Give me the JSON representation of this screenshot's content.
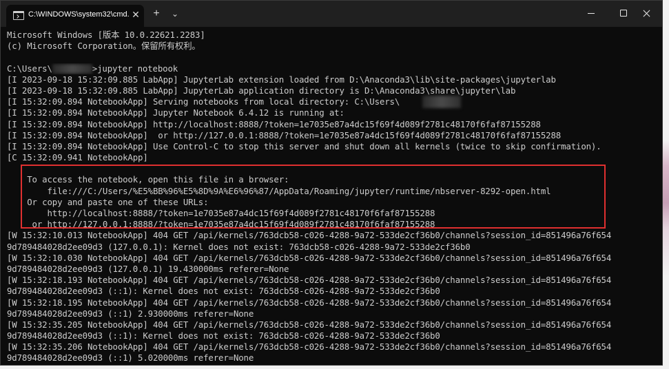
{
  "window": {
    "tab_title": "C:\\WINDOWS\\system32\\cmd.",
    "tab_close_glyph": "✕",
    "new_tab_glyph": "+",
    "dropdown_glyph": "⌄",
    "colors": {
      "console_bg": "#0c0c0c",
      "console_text": "#cccccc",
      "titlebar_bg": "#202020",
      "highlight_border": "#e03030"
    }
  },
  "console": {
    "lines": [
      "Microsoft Windows [版本 10.0.22621.2283]",
      "(c) Microsoft Corporation。保留所有权利。",
      "",
      "C:\\Users\\",
      "[I 2023-09-18 15:32:09.885 LabApp] JupyterLab extension loaded from D:\\Anaconda3\\lib\\site-packages\\jupyterlab",
      "[I 2023-09-18 15:32:09.885 LabApp] JupyterLab application directory is D:\\Anaconda3\\share\\jupyter\\lab",
      "[I 15:32:09.894 NotebookApp] Serving notebooks from local directory: C:\\Users\\",
      "[I 15:32:09.894 NotebookApp] Jupyter Notebook 6.4.12 is running at:",
      "[I 15:32:09.894 NotebookApp] http://localhost:8888/?token=1e7035e87a4dc15f69f4d089f2781c48170f6faf87155288",
      "[I 15:32:09.894 NotebookApp]  or http://127.0.0.1:8888/?token=1e7035e87a4dc15f69f4d089f2781c48170f6faf87155288",
      "[I 15:32:09.894 NotebookApp] Use Control-C to stop this server and shut down all kernels (twice to skip confirmation).",
      "[C 15:32:09.941 NotebookApp]",
      "",
      "    To access the notebook, open this file in a browser:",
      "        file:///C:/Users/%E5%BB%96%E5%8D%9A%E6%96%87/AppData/Roaming/jupyter/runtime/nbserver-8292-open.html",
      "    Or copy and paste one of these URLs:",
      "        http://localhost:8888/?token=1e7035e87a4dc15f69f4d089f2781c48170f6faf87155288",
      "     or http://127.0.0.1:8888/?token=1e7035e87a4dc15f69f4d089f2781c48170f6faf87155288",
      "[W 15:32:10.013 NotebookApp] 404 GET /api/kernels/763dcb58-c026-4288-9a72-533de2cf36b0/channels?session_id=851496a76f654",
      "9d789484028d2ee09d3 (127.0.0.1): Kernel does not exist: 763dcb58-c026-4288-9a72-533de2cf36b0",
      "[W 15:32:10.030 NotebookApp] 404 GET /api/kernels/763dcb58-c026-4288-9a72-533de2cf36b0/channels?session_id=851496a76f654",
      "9d789484028d2ee09d3 (127.0.0.1) 19.430000ms referer=None",
      "[W 15:32:18.193 NotebookApp] 404 GET /api/kernels/763dcb58-c026-4288-9a72-533de2cf36b0/channels?session_id=851496a76f654",
      "9d789484028d2ee09d3 (::1): Kernel does not exist: 763dcb58-c026-4288-9a72-533de2cf36b0",
      "[W 15:32:18.195 NotebookApp] 404 GET /api/kernels/763dcb58-c026-4288-9a72-533de2cf36b0/channels?session_id=851496a76f654",
      "9d789484028d2ee09d3 (::1) 2.930000ms referer=None",
      "[W 15:32:35.205 NotebookApp] 404 GET /api/kernels/763dcb58-c026-4288-9a72-533de2cf36b0/channels?session_id=851496a76f654",
      "9d789484028d2ee09d3 (::1): Kernel does not exist: 763dcb58-c026-4288-9a72-533de2cf36b0",
      "[W 15:32:35.206 NotebookApp] 404 GET /api/kernels/763dcb58-c026-4288-9a72-533de2cf36b0/channels?session_id=851496a76f654",
      "9d789484028d2ee09d3 (::1) 5.020000ms referer=None"
    ],
    "prompt_command": ">jupyter notebook"
  }
}
